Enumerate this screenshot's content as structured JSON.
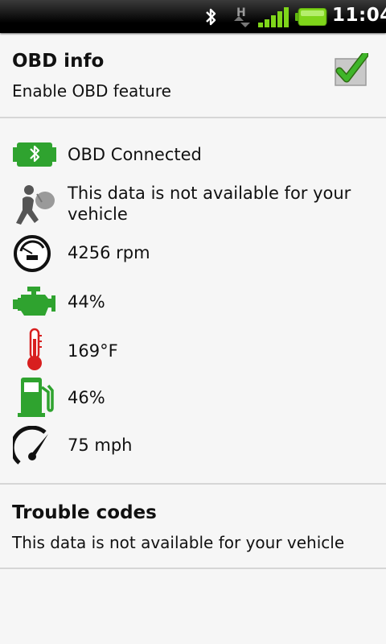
{
  "status_bar": {
    "time": "11:04",
    "network_type": "H",
    "icons": [
      "bluetooth-icon",
      "hspa-data-icon",
      "signal-strength-icon",
      "battery-icon"
    ]
  },
  "obd_pref": {
    "title": "OBD info",
    "summary": "Enable OBD feature",
    "checked": true
  },
  "readings": [
    {
      "icon": "obd-connector-icon",
      "text": "OBD Connected"
    },
    {
      "icon": "airbag-icon",
      "text": "This data is not available for your vehicle"
    },
    {
      "icon": "tachometer-icon",
      "text": "4256 rpm"
    },
    {
      "icon": "engine-icon",
      "text": "44%"
    },
    {
      "icon": "thermometer-icon",
      "text": "169°F"
    },
    {
      "icon": "fuel-pump-icon",
      "text": "46%"
    },
    {
      "icon": "speedometer-icon",
      "text": "75 mph"
    }
  ],
  "trouble_pref": {
    "title": "Trouble codes",
    "summary": "This data is not available for your vehicle"
  },
  "colors": {
    "accent_green": "#2fa32f",
    "thermometer_red": "#d81f1f",
    "divider": "#d6d6d6",
    "background": "#f6f6f6"
  }
}
